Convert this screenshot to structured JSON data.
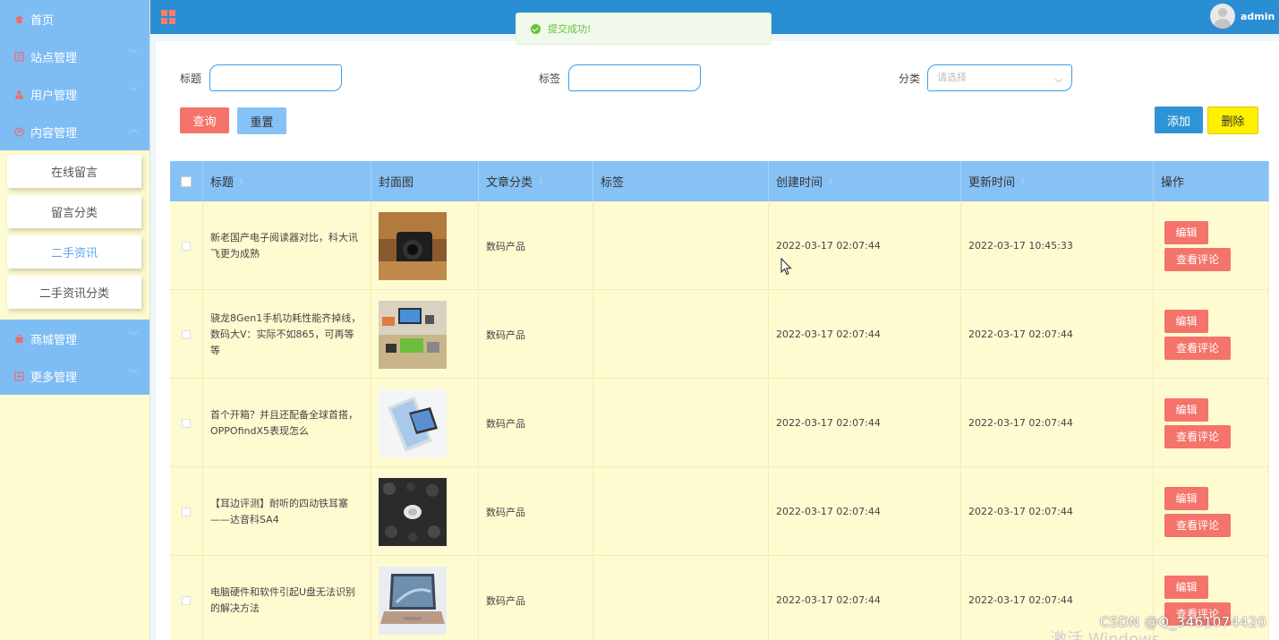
{
  "sidebar": {
    "items": [
      {
        "label": "首页",
        "icon": "home-icon"
      },
      {
        "label": "站点管理",
        "icon": "site-icon"
      },
      {
        "label": "用户管理",
        "icon": "user-icon"
      },
      {
        "label": "内容管理",
        "icon": "content-icon"
      }
    ],
    "sub_items": [
      {
        "label": "在线留言"
      },
      {
        "label": "留言分类"
      },
      {
        "label": "二手资讯"
      },
      {
        "label": "二手资讯分类"
      }
    ],
    "items_after": [
      {
        "label": "商城管理",
        "icon": "shop-icon"
      },
      {
        "label": "更多管理",
        "icon": "more-icon"
      }
    ]
  },
  "header": {
    "user_name": "admin"
  },
  "toast": {
    "message": "提交成功!"
  },
  "search": {
    "title_label": "标题",
    "tag_label": "标签",
    "category_label": "分类",
    "category_placeholder": "请选择",
    "query_button": "查询",
    "reset_button": "重置",
    "add_button": "添加",
    "delete_button": "删除"
  },
  "table": {
    "columns": [
      "标题",
      "封面图",
      "文章分类",
      "标签",
      "创建时间",
      "更新时间",
      "操作"
    ],
    "rows": [
      {
        "title": "新老国产电子阅读器对比，科大讯飞更为成熟",
        "category": "数码产品",
        "tag": "",
        "created": "2022-03-17 02:07:44",
        "updated": "2022-03-17 10:45:33",
        "image": "camera"
      },
      {
        "title": "骁龙8Gen1手机功耗性能齐掉线，数码大V：实际不如865，可再等等",
        "category": "数码产品",
        "tag": "",
        "created": "2022-03-17 02:07:44",
        "updated": "2022-03-17 02:07:44",
        "image": "desk"
      },
      {
        "title": "首个开箱？并且还配备全球首搭，OPPOfindX5表现怎么",
        "category": "数码产品",
        "tag": "",
        "created": "2022-03-17 02:07:44",
        "updated": "2022-03-17 02:07:44",
        "image": "phone"
      },
      {
        "title": "【耳边评测】耐听的四动铁耳塞——达音科SA4",
        "category": "数码产品",
        "tag": "",
        "created": "2022-03-17 02:07:44",
        "updated": "2022-03-17 02:07:44",
        "image": "earbuds"
      },
      {
        "title": "电脑硬件和软件引起U盘无法识别的解决方法",
        "category": "数码产品",
        "tag": "",
        "created": "2022-03-17 02:07:44",
        "updated": "2022-03-17 02:07:44",
        "image": "laptop"
      }
    ],
    "edit_label": "编辑",
    "comment_label": "查看评论"
  },
  "overlay": {
    "watermark": "CSDN @Q_3461074420",
    "windows_text": "激活 Windows"
  }
}
